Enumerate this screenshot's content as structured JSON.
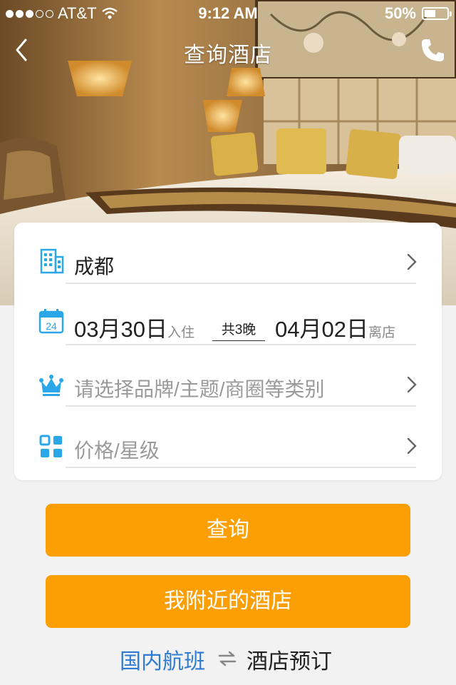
{
  "status_bar": {
    "carrier": "AT&T",
    "time": "9:12 AM",
    "battery_text": "50%",
    "battery_level": 0.5,
    "signal_bars_filled": 3,
    "signal_bars_total": 5
  },
  "nav": {
    "title": "查询酒店",
    "back_icon": "chevron-left-icon",
    "phone_icon": "phone-icon"
  },
  "form": {
    "city": {
      "value": "成都",
      "icon": "building-icon"
    },
    "dates": {
      "icon": "calendar-icon",
      "calendar_day": "24",
      "checkin_date": "03月30日",
      "checkin_label": "入住",
      "nights": "共3晚",
      "checkout_date": "04月02日",
      "checkout_label": "离店"
    },
    "category": {
      "placeholder": "请选择品牌/主题/商圈等类别",
      "icon": "crown-icon"
    },
    "price": {
      "placeholder": "价格/星级",
      "icon": "grid-icon"
    }
  },
  "buttons": {
    "query_label": "查询",
    "nearby_label": "我附近的酒店"
  },
  "footer": {
    "flight_label": "国内航班",
    "hotel_label": "酒店预订",
    "swap_icon": "swap-arrows-icon"
  },
  "colors": {
    "accent_orange": "#fb9f05",
    "icon_blue": "#29a7e8",
    "link_blue": "#2f7bd3",
    "background": "#f2f2f2"
  }
}
